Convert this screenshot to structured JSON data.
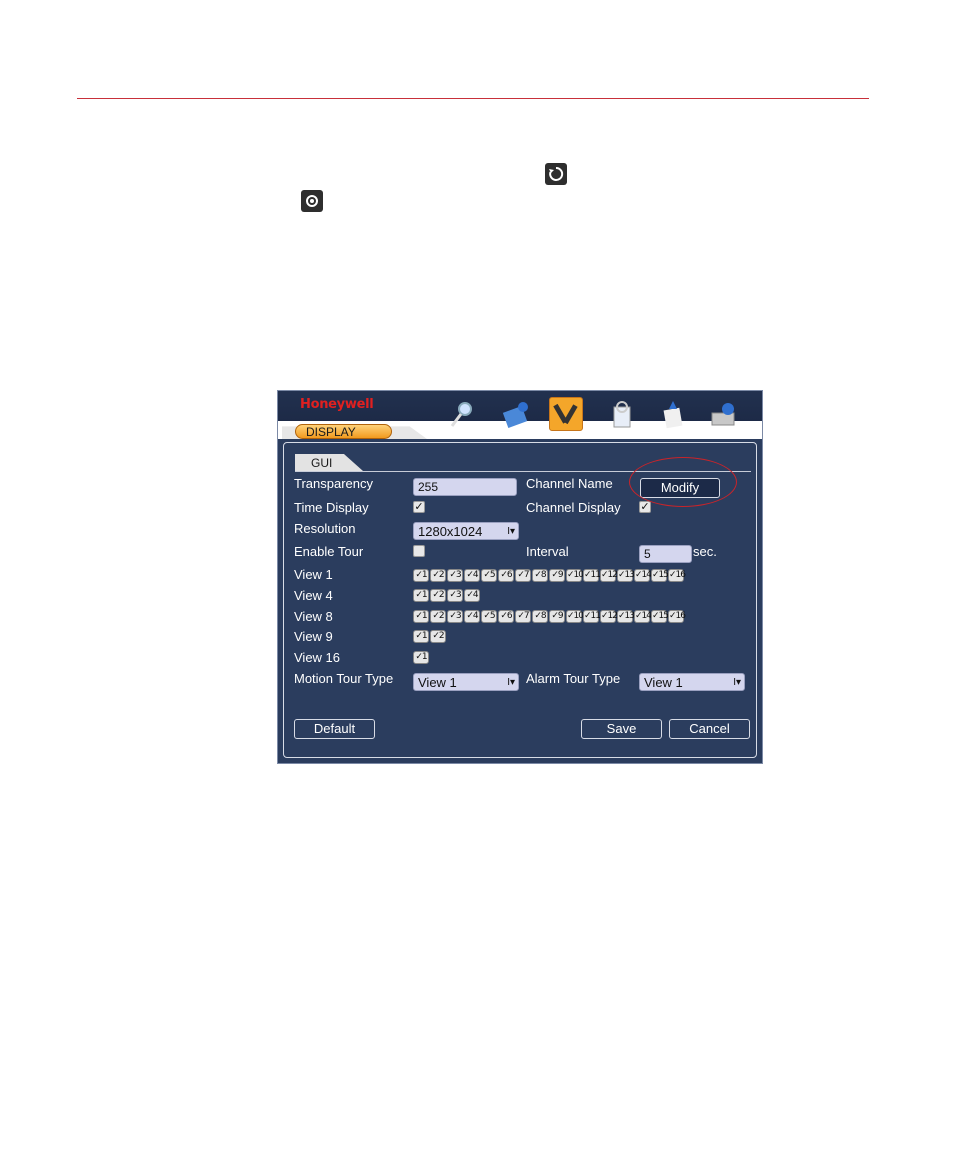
{
  "window": {
    "brand": "Honeywell",
    "tab": "DISPLAY",
    "subtab": "GUI"
  },
  "form": {
    "transparency": {
      "label": "Transparency",
      "value": "255"
    },
    "channel_name": {
      "label": "Channel Name",
      "button": "Modify"
    },
    "time_display": {
      "label": "Time Display",
      "checked": true
    },
    "channel_display": {
      "label": "Channel Display",
      "checked": true
    },
    "resolution": {
      "label": "Resolution",
      "value": "1280x1024"
    },
    "enable_tour": {
      "label": "Enable Tour",
      "checked": false
    },
    "interval": {
      "label": "Interval",
      "value": "5",
      "unit": "sec."
    },
    "views": [
      {
        "label": "View 1",
        "count": 16
      },
      {
        "label": "View 4",
        "count": 4
      },
      {
        "label": "View 8",
        "count": 16
      },
      {
        "label": "View 9",
        "count": 2
      },
      {
        "label": "View 16",
        "count": 1
      }
    ],
    "motion_tour_type": {
      "label": "Motion Tour Type",
      "value": "View 1"
    },
    "alarm_tour_type": {
      "label": "Alarm Tour Type",
      "value": "View 1"
    }
  },
  "buttons": {
    "default": "Default",
    "save": "Save",
    "cancel": "Cancel"
  },
  "icons": [
    "refresh-icon",
    "refresh-alt-icon",
    "search-icon",
    "info-icon",
    "setting-icon",
    "advanced-icon",
    "backup-icon",
    "shutdown-icon"
  ]
}
